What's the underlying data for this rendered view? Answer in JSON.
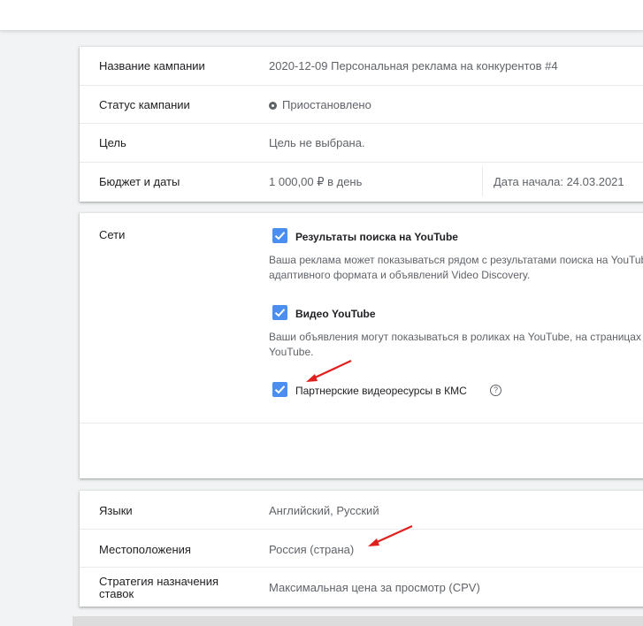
{
  "campaign": {
    "name_label": "Название кампании",
    "name_value": "2020-12-09 Персональная реклама на конкурентов #4",
    "status_label": "Статус кампании",
    "status_value": "Приостановлено",
    "goal_label": "Цель",
    "goal_value": "Цель не выбрана.",
    "budget_label": "Бюджет и даты",
    "budget_value": "1 000,00 ₽ в день",
    "start_date": "Дата начала: 24.03.2021"
  },
  "networks": {
    "label": "Сети",
    "options": [
      {
        "title": "Результаты поиска на YouTube",
        "desc_line1": "Ваша реклама может показываться рядом с результатами поиска на YouTube",
        "desc_line2": "адаптивного формата и объявлений Video Discovery.",
        "checked": true
      },
      {
        "title": "Видео YouTube",
        "desc_line1": "Ваши объявления могут показываться в роликах на YouTube, на страницах",
        "desc_line2": "YouTube.",
        "checked": true
      },
      {
        "title": "Партнерские видеоресурсы в КМС",
        "checked": true
      }
    ],
    "help_glyph": "?"
  },
  "settings": {
    "languages_label": "Языки",
    "languages_value": "Английский, Русский",
    "locations_label": "Местоположения",
    "locations_value": "Россия (страна)",
    "bidding_label_line1": "Стратегия назначения",
    "bidding_label_line2": "ставок",
    "bidding_value": "Максимальная цена за просмотр (CPV)"
  },
  "icons": {
    "checkbox": "check-icon",
    "status": "paused-status-icon",
    "help": "help-circle-icon",
    "annotation": "red-arrow-icon"
  },
  "colors": {
    "checkbox": "#4a8ff0",
    "annotation_arrow": "#e0201f",
    "page_bg": "#f1f3f4"
  }
}
